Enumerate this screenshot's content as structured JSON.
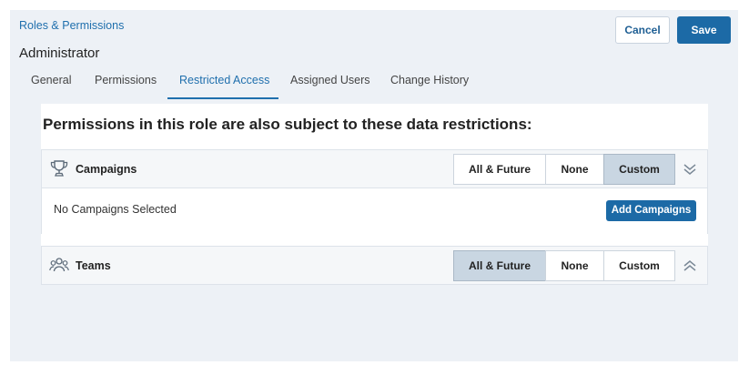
{
  "header": {
    "breadcrumb": "Roles & Permissions",
    "role_title": "Administrator",
    "cancel_label": "Cancel",
    "save_label": "Save"
  },
  "tabs": [
    {
      "label": "General",
      "active": false
    },
    {
      "label": "Permissions",
      "active": false
    },
    {
      "label": "Restricted Access",
      "active": true
    },
    {
      "label": "Assigned Users",
      "active": false
    },
    {
      "label": "Change History",
      "active": false
    }
  ],
  "main": {
    "heading": "Permissions in this role are also subject to these data restrictions:",
    "sections": [
      {
        "title": "Campaigns",
        "icon": "trophy-icon",
        "options": [
          "All & Future",
          "None",
          "Custom"
        ],
        "selected": "Custom",
        "expanded": true,
        "empty_text": "No Campaigns Selected",
        "add_label": "Add Campaigns"
      },
      {
        "title": "Teams",
        "icon": "users-icon",
        "options": [
          "All & Future",
          "None",
          "Custom"
        ],
        "selected": "All & Future",
        "expanded": false
      }
    ]
  },
  "colors": {
    "accent": "#1c6aa6",
    "link": "#1f6fad",
    "page_bg": "#edf1f6",
    "selected_segment": "#c9d6e2"
  }
}
